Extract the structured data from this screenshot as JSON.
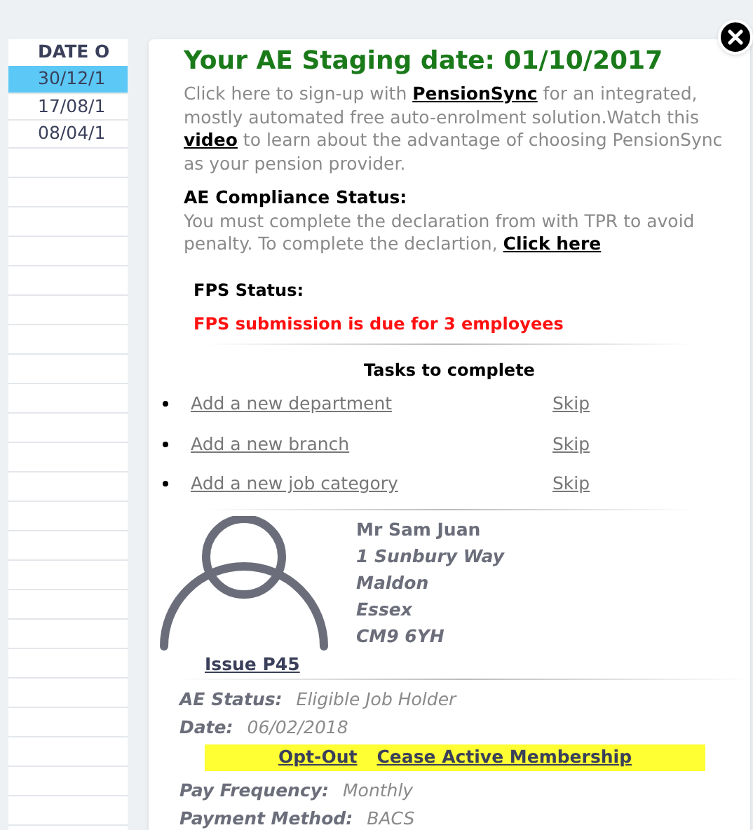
{
  "table": {
    "columns": [
      "DATE O"
    ],
    "rows": [
      {
        "cells": [
          "30/12/1"
        ],
        "selected": true
      },
      {
        "cells": [
          "17/08/1"
        ],
        "selected": false
      },
      {
        "cells": [
          "08/04/1"
        ],
        "selected": false
      }
    ]
  },
  "popup": {
    "title": "Your AE Staging date: 01/10/2017",
    "intro": [
      {
        "kind": "text",
        "text": "Click here to sign-up with "
      },
      {
        "kind": "link",
        "text": "PensionSync"
      },
      {
        "kind": "text",
        "text": " for an integrated, mostly automated free auto-enrolment solution.Watch this "
      },
      {
        "kind": "link",
        "text": "video"
      },
      {
        "kind": "text",
        "text": " to learn about the advantage of choosing PensionSync as your pension provider."
      }
    ],
    "compliance_heading": "AE Compliance Status:",
    "compliance": [
      {
        "kind": "text",
        "text": "You must complete the declaration from with TPR to avoid penalty. To complete the declartion, "
      },
      {
        "kind": "link",
        "text": "Click here"
      }
    ],
    "fps_heading": "FPS Status:",
    "fps_message": "FPS submission is due for 3 employees",
    "tasks_heading": "Tasks to complete",
    "tasks": [
      {
        "label": "Add a new department",
        "action": "Skip"
      },
      {
        "label": "Add a new branch",
        "action": "Skip"
      },
      {
        "label": "Add a new job category",
        "action": "Skip"
      }
    ],
    "employee": {
      "name": "Mr Sam Juan",
      "address": [
        "1 Sunbury Way",
        "Maldon",
        "Essex",
        "CM9 6YH"
      ],
      "action": "Issue P45"
    },
    "ae_details": [
      {
        "label": "AE Status:",
        "value": "Eligible Job Holder"
      },
      {
        "label": "Date:",
        "value": "06/02/2018"
      }
    ],
    "membership_actions": [
      "Opt-Out",
      "Cease Active Membership"
    ],
    "pay_details": [
      {
        "label": "Pay Frequency:",
        "value": "Monthly"
      },
      {
        "label": "Payment Method:",
        "value": "BACS"
      }
    ]
  }
}
